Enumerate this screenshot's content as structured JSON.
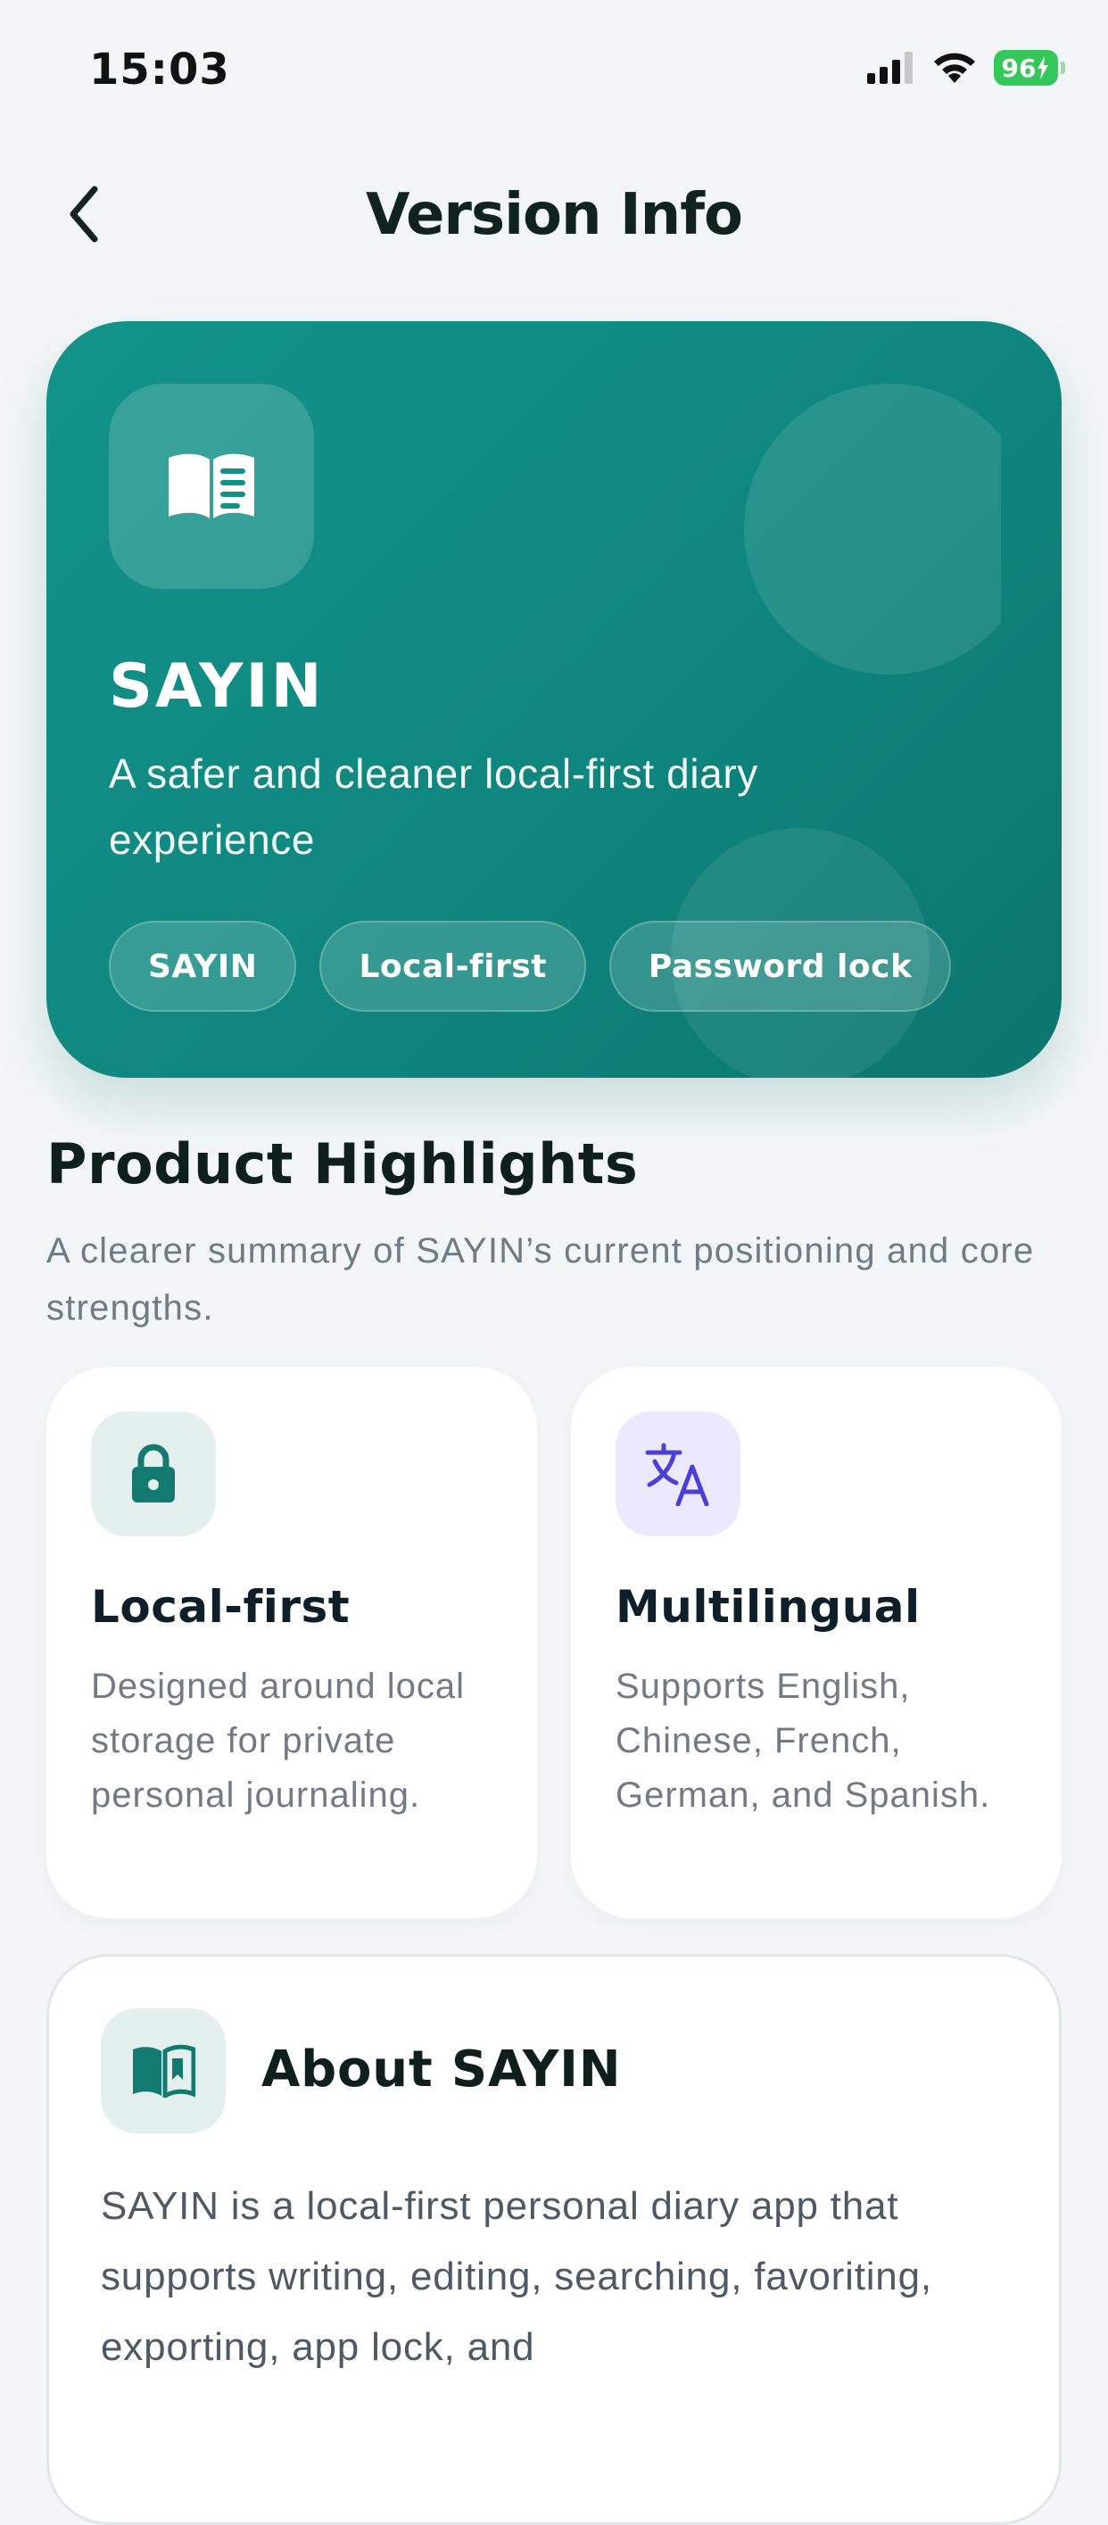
{
  "status_bar": {
    "time": "15:03",
    "battery": "96"
  },
  "header": {
    "title": "Version Info"
  },
  "hero": {
    "title": "SAYIN",
    "subtitle": "A safer and cleaner local-first diary experience",
    "tags": [
      "SAYIN",
      "Local-first",
      "Password lock"
    ]
  },
  "highlights": {
    "title": "Product Highlights",
    "subtitle": "A clearer summary of SAYIN’s current positioning and core strengths.",
    "cards": [
      {
        "title": "Local-first",
        "description": "Designed around local storage for private personal journaling.",
        "icon": "lock-icon"
      },
      {
        "title": "Multilingual",
        "description": "Supports English, Chinese, French, German, and Spanish.",
        "icon": "translate-icon"
      }
    ]
  },
  "about": {
    "title": "About SAYIN",
    "text": "SAYIN is a local-first personal diary app that supports writing, editing, searching, favoriting, exporting, app lock, and",
    "icon": "open-book-icon"
  },
  "colors": {
    "brand": "#11908a",
    "accent_purple": "#4b3fd6",
    "background": "#f3f6f8"
  }
}
